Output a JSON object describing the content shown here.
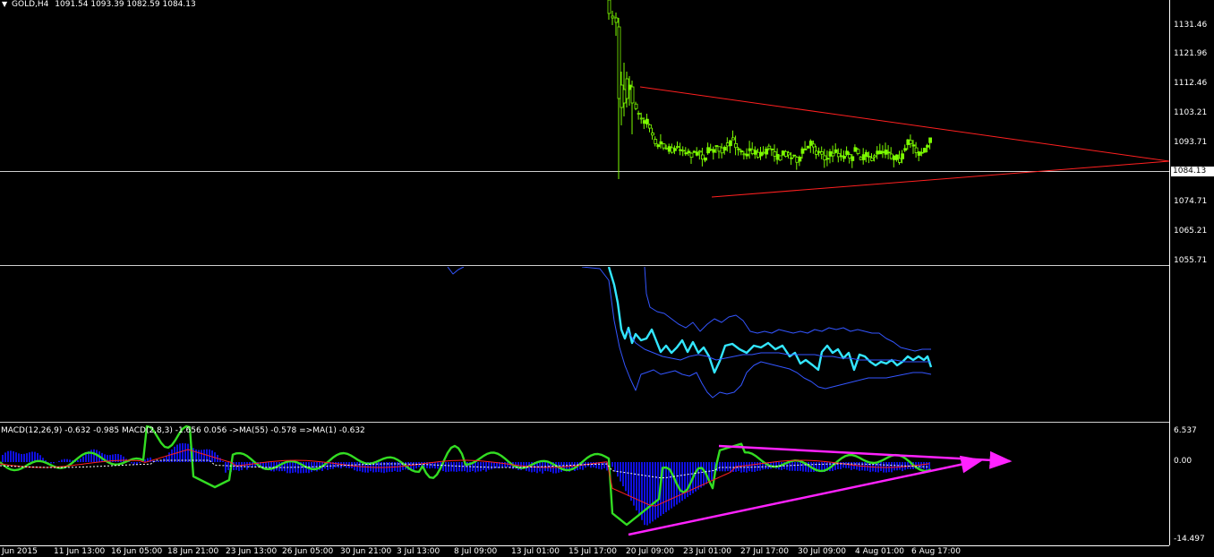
{
  "header": {
    "symbol_label": "GOLD,H4",
    "ohlc": "1091.54 1093.39 1082.59 1084.13"
  },
  "price_axis": {
    "labels": [
      "1131.46",
      "1121.96",
      "1112.46",
      "1103.21",
      "1093.71",
      "1074.71",
      "1065.21",
      "1055.71"
    ],
    "current_price": "1084.13"
  },
  "macd_axis": {
    "labels": [
      "6.537",
      "0.00",
      "-14.497"
    ]
  },
  "macd_header": "MACD(12,26,9) -0.632 -0.985  MACD(2,8,3) -1.656 0.056  ->MA(55) -0.578  =>MA(1) -0.632",
  "time_axis": {
    "labels": [
      "Jun 2015",
      "11 Jun 13:00",
      "16 Jun 05:00",
      "18 Jun 21:00",
      "23 Jun 13:00",
      "26 Jun 05:00",
      "30 Jun 21:00",
      "3 Jul 13:00",
      "8 Jul 09:00",
      "13 Jul 01:00",
      "15 Jul 17:00",
      "20 Jul 09:00",
      "23 Jul 01:00",
      "27 Jul 17:00",
      "30 Jul 09:00",
      "4 Aug 01:00",
      "6 Aug 17:00"
    ]
  },
  "colors": {
    "background": "#000000",
    "candles": "#7CFC00",
    "triangle_lines": "#ff2020",
    "oscillator_main": "#33e6ff",
    "oscillator_bands": "#3355ff",
    "macd_histogram": "#1010e0",
    "macd_signal_green": "#33dd22",
    "macd_red_line": "#ff2020",
    "macd_dotted": "#ffffff",
    "arrows": "#ff22ff"
  }
}
